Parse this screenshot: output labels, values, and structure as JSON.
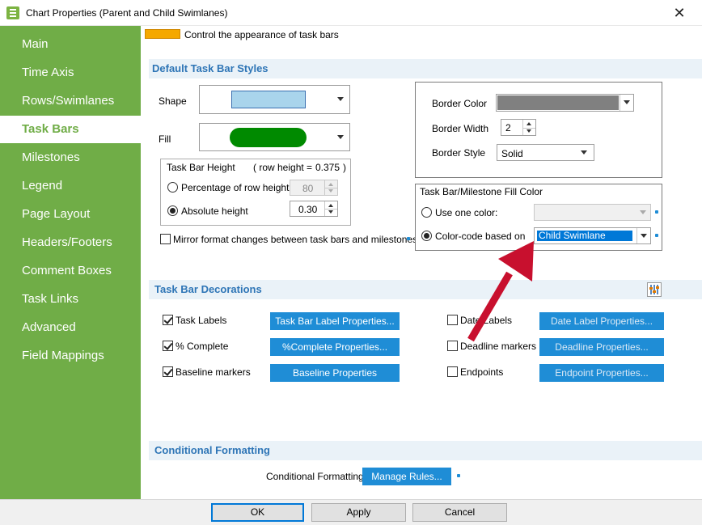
{
  "window": {
    "title": "Chart Properties (Parent and Child Swimlanes)"
  },
  "sidebar": {
    "items": [
      {
        "label": "Main"
      },
      {
        "label": "Time Axis"
      },
      {
        "label": "Rows/Swimlanes"
      },
      {
        "label": "Task Bars",
        "active": true
      },
      {
        "label": "Milestones"
      },
      {
        "label": "Legend"
      },
      {
        "label": "Page Layout"
      },
      {
        "label": "Headers/Footers"
      },
      {
        "label": "Comment Boxes"
      },
      {
        "label": "Task Links"
      },
      {
        "label": "Advanced"
      },
      {
        "label": "Field Mappings"
      }
    ]
  },
  "hint": {
    "text": "Control the appearance of task bars"
  },
  "default_styles": {
    "title": "Default Task Bar Styles",
    "shape_label": "Shape",
    "fill_label": "Fill",
    "shape_color": "#a9d4ec",
    "fill_color": "#008a00",
    "height": {
      "title": "Task Bar Height",
      "row_height_text": "( row height =",
      "row_height_value": "0.375",
      "row_height_close": ")",
      "percentage_label": "Percentage of row height",
      "percentage_value": "80",
      "absolute_label": "Absolute height",
      "absolute_value": "0.30"
    },
    "mirror_label": "Mirror format changes between task bars and milestones",
    "border": {
      "color_label": "Border Color",
      "color_value": "#808080",
      "width_label": "Border Width",
      "width_value": "2",
      "style_label": "Border Style",
      "style_value": "Solid"
    },
    "fill_color_group": {
      "title": "Task Bar/Milestone Fill Color",
      "use_one_label": "Use one color:",
      "color_code_label": "Color-code based on",
      "color_code_value": "Child Swimlane"
    }
  },
  "decorations": {
    "title": "Task Bar Decorations",
    "task_labels": {
      "label": "Task Labels",
      "button": "Task Bar Label Properties..."
    },
    "percent_complete": {
      "label": "% Complete",
      "button": "%Complete Properties..."
    },
    "baseline": {
      "label": "Baseline markers",
      "button": "Baseline Properties"
    },
    "date_labels": {
      "label": "Date Labels",
      "button": "Date Label Properties..."
    },
    "deadline": {
      "label": "Deadline markers",
      "button": "Deadline Properties..."
    },
    "endpoints": {
      "label": "Endpoints",
      "button": "Endpoint Properties..."
    }
  },
  "conditional": {
    "title": "Conditional Formatting",
    "label": "Conditional Formatting",
    "button": "Manage Rules..."
  },
  "footer": {
    "ok": "OK",
    "apply": "Apply",
    "cancel": "Cancel"
  },
  "colors": {
    "accent_green": "#70ad47",
    "button_blue": "#1f8dd6",
    "section_blue": "#2e75b6",
    "arrow_red": "#c8102e"
  }
}
